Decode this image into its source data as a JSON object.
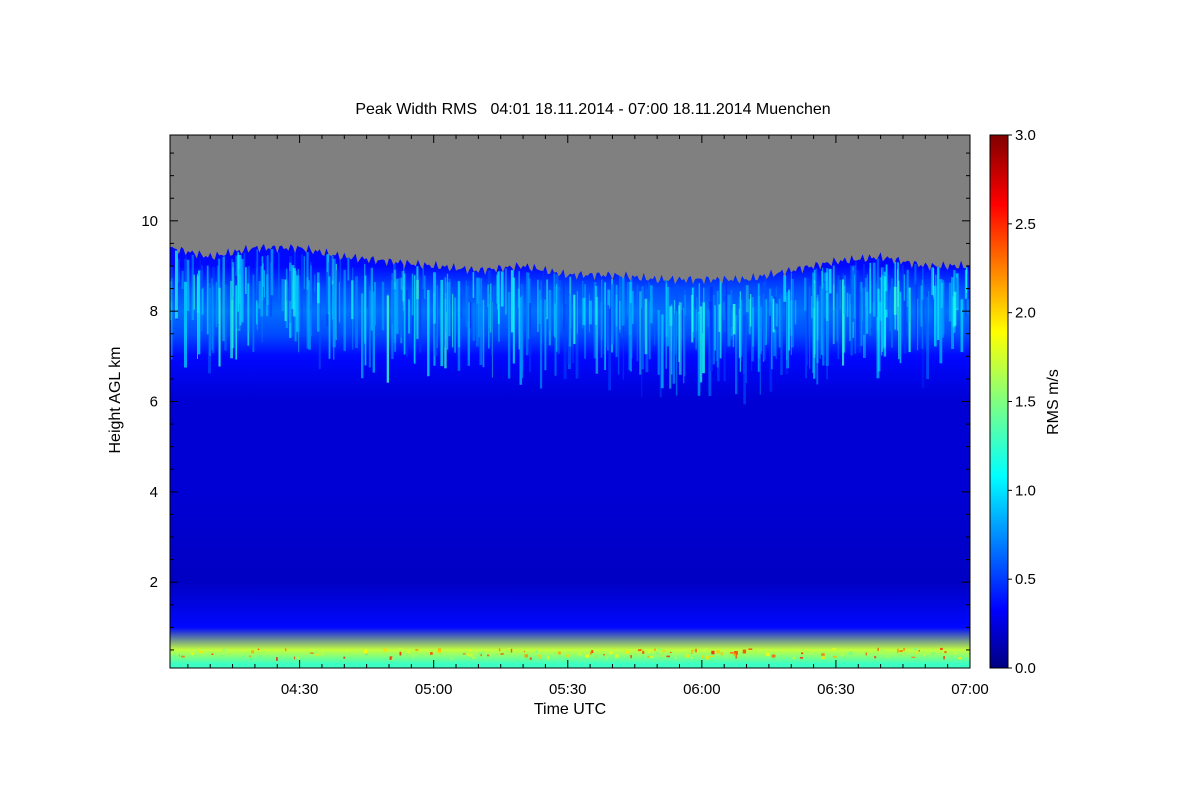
{
  "chart_data": {
    "type": "heatmap",
    "title": "Peak Width RMS   04:01 18.11.2014 - 07:00 18.11.2014 Muenchen",
    "xlabel": "Time UTC",
    "ylabel": "Height AGL km",
    "colorbar_label": "RMS m/s",
    "x_range_minutes_utc": [
      241,
      420
    ],
    "xlim_display": [
      "04:01",
      "07:00"
    ],
    "xticks": [
      {
        "value": 270,
        "label": "04:30"
      },
      {
        "value": 300,
        "label": "05:00"
      },
      {
        "value": 330,
        "label": "05:30"
      },
      {
        "value": 360,
        "label": "06:00"
      },
      {
        "value": 390,
        "label": "06:30"
      },
      {
        "value": 420,
        "label": "07:00"
      }
    ],
    "ylim": [
      0.1,
      11.9
    ],
    "yticks": [
      {
        "value": 2,
        "label": "2"
      },
      {
        "value": 4,
        "label": "4"
      },
      {
        "value": 6,
        "label": "6"
      },
      {
        "value": 8,
        "label": "8"
      },
      {
        "value": 10,
        "label": "10"
      }
    ],
    "colorbar": {
      "range": [
        0.0,
        3.0
      ],
      "colormap": "jet",
      "ticks": [
        {
          "value": 0.0,
          "label": "0.0"
        },
        {
          "value": 0.5,
          "label": "0.5"
        },
        {
          "value": 1.0,
          "label": "1.0"
        },
        {
          "value": 1.5,
          "label": "1.5"
        },
        {
          "value": 2.0,
          "label": "2.0"
        },
        {
          "value": 2.5,
          "label": "2.5"
        },
        {
          "value": 3.0,
          "label": "3.0"
        }
      ]
    },
    "no_data_color": "#808080",
    "signal_top_height_km": {
      "time_utc": [
        "04:01",
        "04:10",
        "04:20",
        "04:30",
        "04:40",
        "04:50",
        "05:00",
        "05:10",
        "05:20",
        "05:30",
        "05:40",
        "05:50",
        "06:00",
        "06:10",
        "06:20",
        "06:30",
        "06:40",
        "06:50",
        "07:00"
      ],
      "height_km": [
        9.4,
        9.2,
        9.4,
        9.4,
        9.2,
        9.1,
        9.0,
        8.9,
        9.0,
        8.8,
        8.8,
        8.7,
        8.7,
        8.7,
        8.9,
        9.1,
        9.2,
        9.0,
        9.0
      ]
    },
    "rms_profile": {
      "height_km": [
        0.2,
        0.5,
        1.0,
        2.0,
        4.0,
        6.0,
        7.0,
        7.5,
        8.0,
        8.5,
        9.0
      ],
      "rms_ms": [
        1.3,
        1.7,
        0.4,
        0.2,
        0.25,
        0.25,
        0.4,
        0.6,
        0.7,
        0.6,
        0.4
      ]
    }
  }
}
